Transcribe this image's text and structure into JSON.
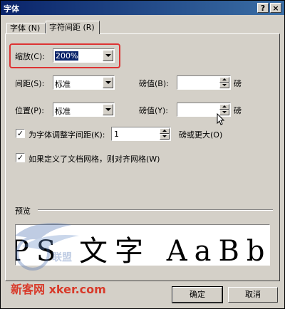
{
  "window": {
    "title": "字体",
    "help_label": "?",
    "close_label": "×"
  },
  "tabs": [
    {
      "label": "字体 (N)"
    },
    {
      "label": "字符间距 (R)"
    }
  ],
  "scale": {
    "label": "缩放(C):",
    "value": "200%"
  },
  "spacing": {
    "label": "间距(S):",
    "value": "标准",
    "by_label": "磅值(B):",
    "by_value": "",
    "unit": "磅"
  },
  "position": {
    "label": "位置(P):",
    "value": "标准",
    "by_label": "磅值(Y):",
    "by_value": "",
    "unit": "磅"
  },
  "kerning": {
    "checked": true,
    "label": "为字体调整字间距(K):",
    "value": "1",
    "suffix": "磅或更大(O)"
  },
  "snap_grid": {
    "checked": true,
    "label": "如果定义了文档网格，则对齐网格(W)"
  },
  "preview": {
    "label": "预览",
    "text": "PS 文字 AaBb"
  },
  "buttons": {
    "ok": "确定",
    "cancel": "取消"
  },
  "watermark": {
    "text": "新客网 xker.com",
    "logo_text": "联盟"
  }
}
